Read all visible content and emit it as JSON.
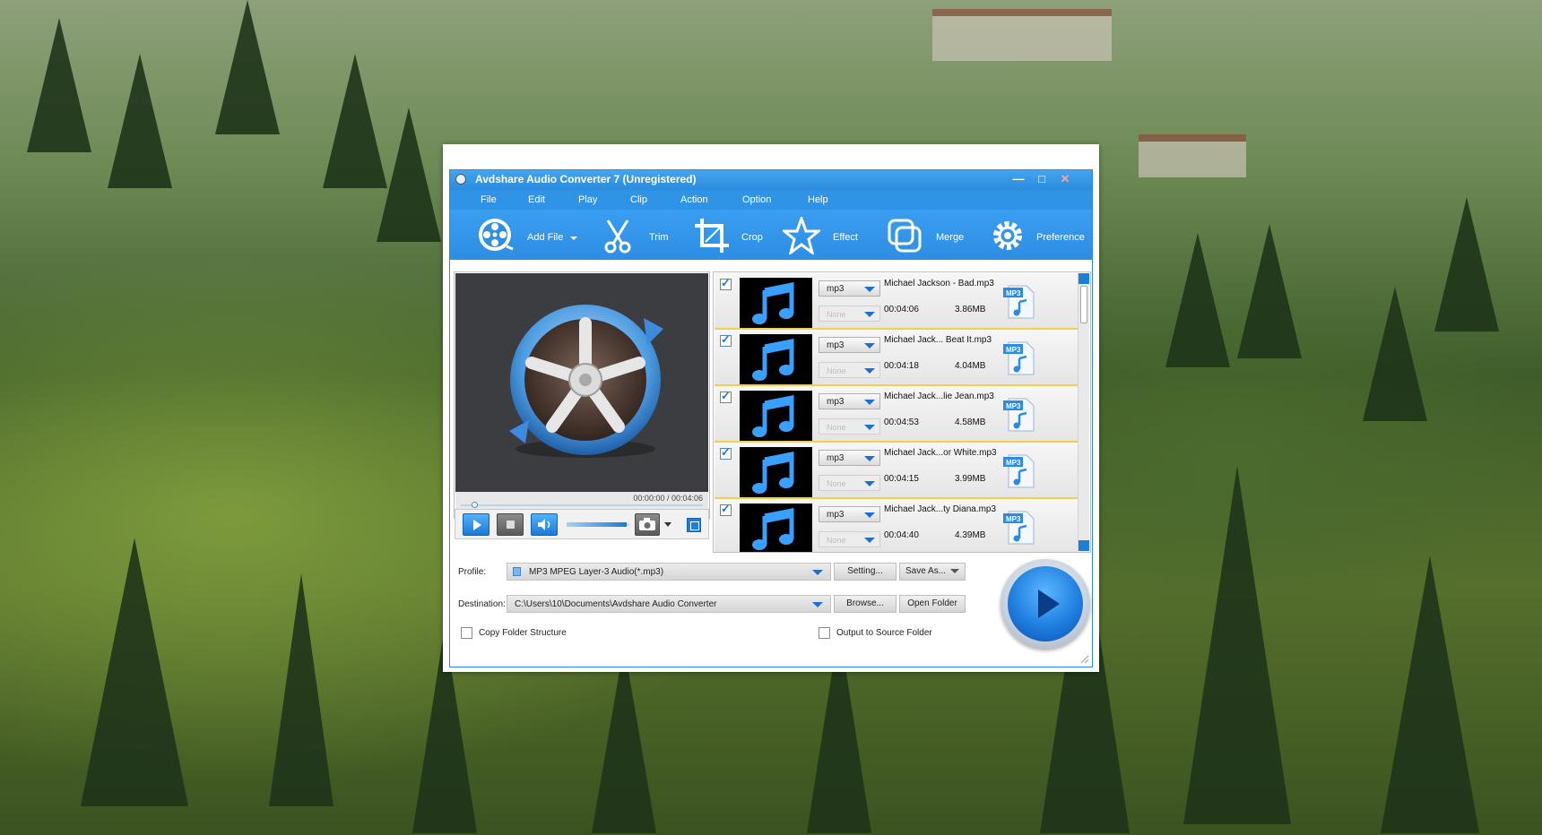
{
  "window": {
    "title": "Avdshare Audio Converter 7 (Unregistered)",
    "minimize_glyph": "—",
    "maximize_glyph": "□",
    "close_glyph": "✕"
  },
  "menu": [
    "File",
    "Edit",
    "Play",
    "Clip",
    "Action",
    "Option",
    "Help"
  ],
  "toolbar": {
    "add_file": "Add File",
    "trim": "Trim",
    "crop": "Crop",
    "effect": "Effect",
    "merge": "Merge",
    "preference": "Preference"
  },
  "player": {
    "time_display": "00:00:00 / 00:04:06",
    "progress": 0.0,
    "volume_level": 0.95
  },
  "files": [
    {
      "name": "Michael Jackson - Bad.mp3",
      "format": "mp3",
      "subtitle": "None",
      "duration": "00:04:06",
      "size": "3.86MB",
      "badge": "MP3"
    },
    {
      "name": "Michael Jack... Beat It.mp3",
      "format": "mp3",
      "subtitle": "None",
      "duration": "00:04:18",
      "size": "4.04MB",
      "badge": "MP3"
    },
    {
      "name": "Michael Jack...lie Jean.mp3",
      "format": "mp3",
      "subtitle": "None",
      "duration": "00:04:53",
      "size": "4.58MB",
      "badge": "MP3"
    },
    {
      "name": "Michael Jack...or White.mp3",
      "format": "mp3",
      "subtitle": "None",
      "duration": "00:04:15",
      "size": "3.99MB",
      "badge": "MP3"
    },
    {
      "name": "Michael Jack...ty Diana.mp3",
      "format": "mp3",
      "subtitle": "None",
      "duration": "00:04:40",
      "size": "4.39MB",
      "badge": "MP3"
    }
  ],
  "output": {
    "profile_label": "Profile:",
    "profile_value": "MP3 MPEG Layer-3 Audio(*.mp3)",
    "settings_button": "Setting...",
    "save_as_button": "Save As...",
    "destination_label": "Destination:",
    "destination_value": "C:\\Users\\10\\Documents\\Avdshare Audio Converter",
    "browse_button": "Browse...",
    "open_folder_button": "Open Folder",
    "copy_folder_structure": "Copy Folder Structure",
    "output_to_source_folder": "Output to Source Folder"
  },
  "colors": {
    "accent": "#2f94e6",
    "row_separator": "#f2d04a"
  }
}
